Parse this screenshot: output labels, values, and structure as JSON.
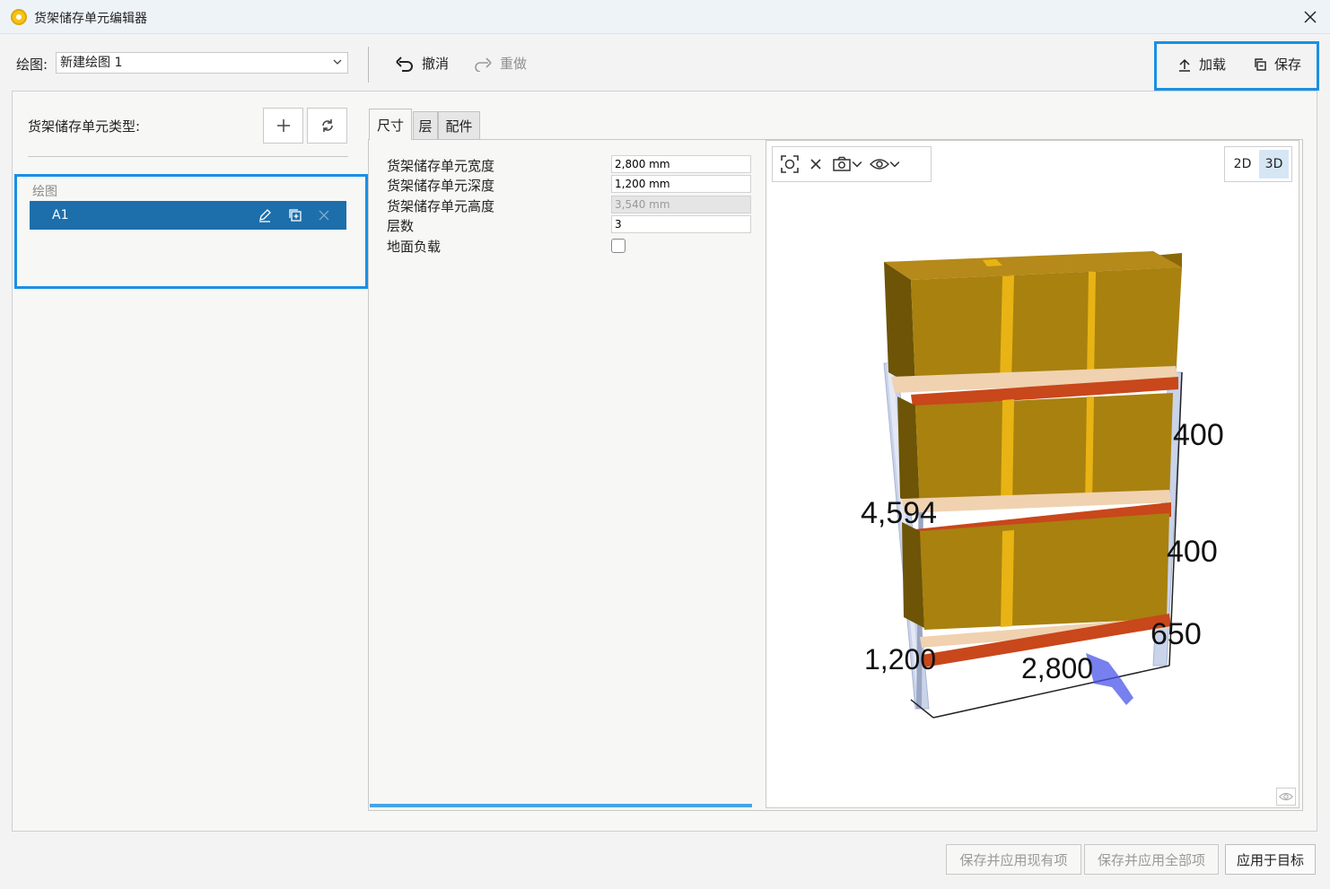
{
  "window": {
    "title": "货架储存单元编辑器"
  },
  "toolbar": {
    "drawing_label": "绘图:",
    "drawing_value": "新建绘图 1",
    "undo_label": "撤消",
    "redo_label": "重做",
    "load_label": "加载",
    "save_label": "保存"
  },
  "left_panel": {
    "types_label": "货架储存单元类型:",
    "group_label": "绘图",
    "items": [
      {
        "label": "A1"
      }
    ]
  },
  "tabs": [
    {
      "label": "尺寸"
    },
    {
      "label": "层"
    },
    {
      "label": "配件"
    }
  ],
  "form": {
    "width_label": "货架储存单元宽度",
    "width_value": "2,800 mm",
    "depth_label": "货架储存单元深度",
    "depth_value": "1,200 mm",
    "height_label": "货架储存单元高度",
    "height_value": "3,540 mm",
    "levels_label": "层数",
    "levels_value": "3",
    "ground_load_label": "地面负载"
  },
  "viewport": {
    "mode_2d": "2D",
    "mode_3d": "3D",
    "dim_top": "400",
    "dim_mid": "400",
    "dim_bottom": "650",
    "dim_height": "4,594",
    "dim_depth": "1,200",
    "dim_width": "2,800",
    "colors": {
      "box": "#a8810f",
      "beam": "#c8471b",
      "upright": "#c9d3ea",
      "arrow": "#4a55e8",
      "accent": "#1990e3"
    }
  },
  "footer": {
    "save_current": "保存并应用现有项",
    "save_all": "保存并应用全部项",
    "apply_target": "应用于目标"
  }
}
